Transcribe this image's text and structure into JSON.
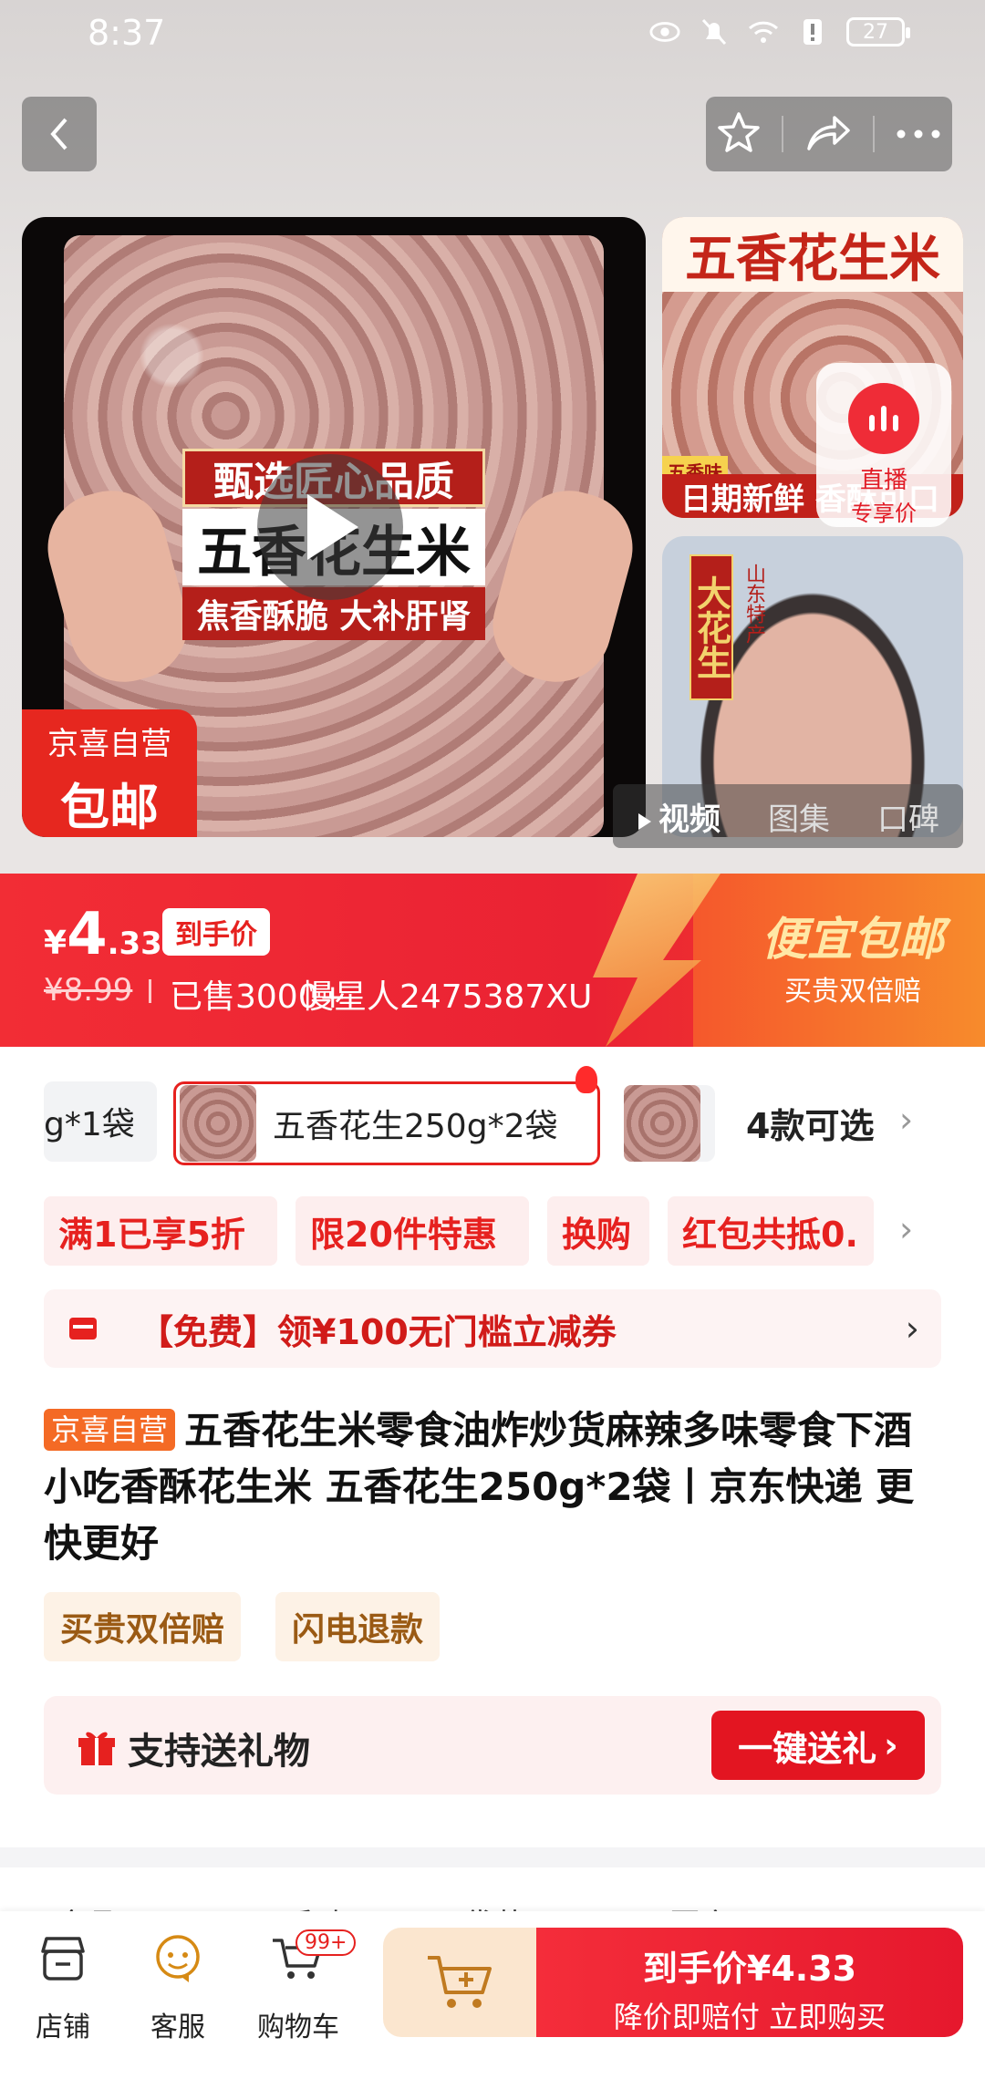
{
  "status_bar": {
    "time": "8:37",
    "battery": "27"
  },
  "nav": {
    "back_icon": "back-arrow-icon",
    "right_icons": [
      "star-icon",
      "share-icon",
      "more-icon"
    ]
  },
  "gallery": {
    "main_image": {
      "tag_top": "甄选匠心品质",
      "tag_mid": "五香花生米",
      "tag_bottom": "焦香酥脆 大补肝肾",
      "badge_line1": "京喜自营",
      "badge_line2": "包邮"
    },
    "thumb1": {
      "title": "五香花生米",
      "flavor_tag": "五香味",
      "strip": "日期新鲜 香酥可口"
    },
    "thumb2": {
      "vertical_title": "大花生",
      "vertical_sub": "山东特产"
    },
    "live": {
      "line1": "直播",
      "line2": "专享价"
    },
    "media_tabs": [
      {
        "label": "视频",
        "active": true
      },
      {
        "label": "图集",
        "active": false
      },
      {
        "label": "口碑",
        "active": false
      }
    ]
  },
  "price": {
    "currency": "¥",
    "integer": "4",
    "decimal": ".33",
    "tag": "到手价",
    "original": "¥8.99",
    "sold": "已售3000+",
    "overlay_user": "慢星人2475387XU",
    "promo_title": "便宜包邮",
    "promo_sub": "买贵双倍赔"
  },
  "variants": {
    "items": [
      "g*1袋",
      "五香花生250g*2袋"
    ],
    "more": "4款可选"
  },
  "promos": [
    "满1已享5折",
    "限20件特惠",
    "换购",
    "红包共抵0."
  ],
  "coupon": {
    "text": "【免费】领¥100无门槛立减券"
  },
  "product": {
    "shop_tag": "京喜自营",
    "title": "五香花生米零食油炸炒货麻辣多味零食下酒小吃香酥花生米 五香花生250g*2袋丨京东快递 更快更好"
  },
  "services": [
    "买贵双倍赔",
    "闪电退款"
  ],
  "gift": {
    "text": "支持送礼物",
    "button": "一键送礼"
  },
  "spec_row": [
    "(全品",
    "五香味",
    "袋装",
    "国产"
  ],
  "bottom_bar": {
    "tools": [
      {
        "label": "店铺",
        "icon": "store-icon"
      },
      {
        "label": "客服",
        "icon": "customer-service-icon"
      },
      {
        "label": "购物车",
        "icon": "cart-icon"
      }
    ],
    "cart_badge": "99+",
    "buy_line1": "到手价¥4.33",
    "buy_line2": "降价即赔付 立即购买"
  },
  "colors": {
    "primary_red": "#e6211f",
    "orange": "#f46a25"
  }
}
